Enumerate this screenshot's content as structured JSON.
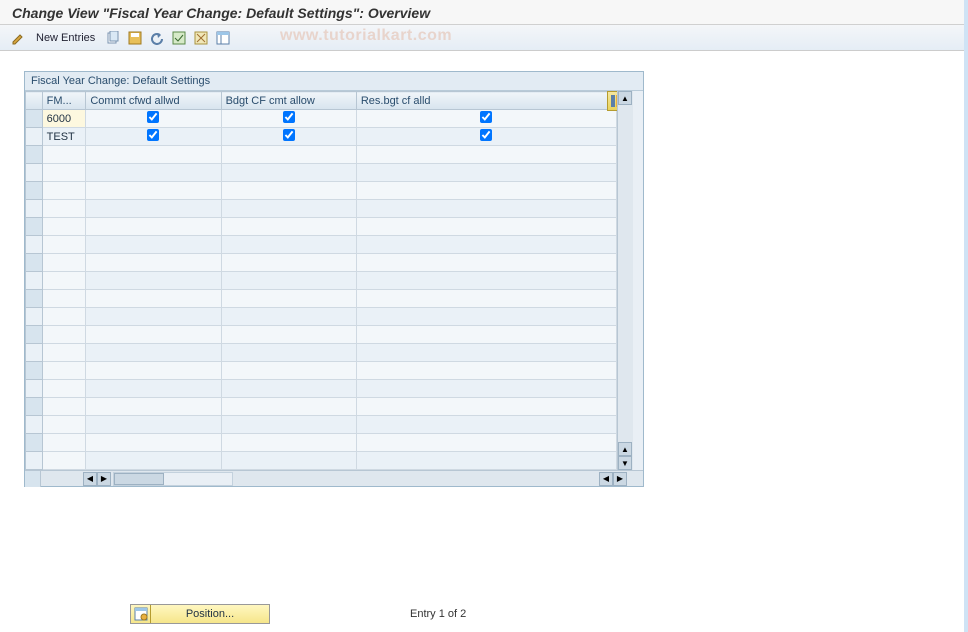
{
  "title": "Change View \"Fiscal Year Change: Default Settings\": Overview",
  "toolbar": {
    "new_entries": "New Entries"
  },
  "watermark": "www.tutorialkart.com",
  "panel": {
    "title": "Fiscal Year Change: Default Settings",
    "columns": {
      "fm": "FM...",
      "commit": "Commt cfwd allwd",
      "bdgt": "Bdgt CF cmt allow",
      "res": "Res.bgt cf alld"
    },
    "rows": [
      {
        "fm": "6000",
        "commit": true,
        "bdgt": true,
        "res": true
      },
      {
        "fm": "TEST",
        "commit": true,
        "bdgt": true,
        "res": true
      }
    ],
    "empty_rows": 18
  },
  "footer": {
    "position_btn": "Position...",
    "entry_text": "Entry 1 of 2"
  }
}
